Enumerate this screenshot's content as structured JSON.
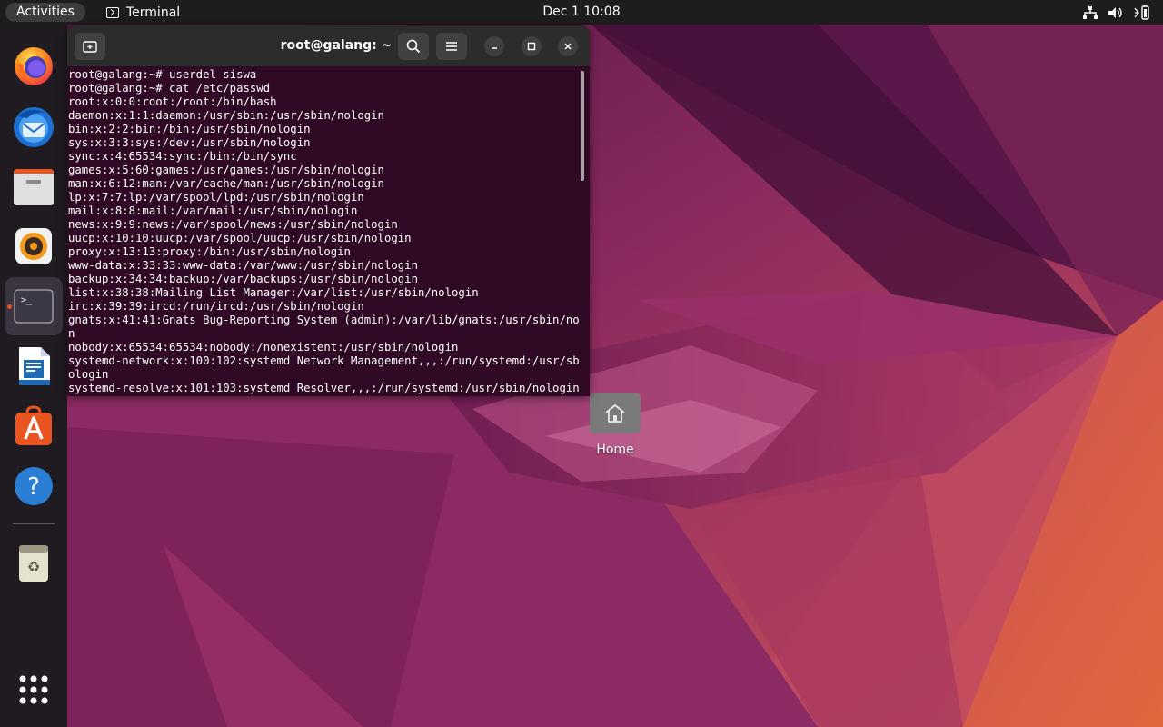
{
  "topbar": {
    "activities_label": "Activities",
    "app_name": "Terminal",
    "clock": "Dec 1  10:08"
  },
  "dock": {
    "items": [
      {
        "name": "Firefox",
        "icon": "firefox-icon"
      },
      {
        "name": "Thunderbird",
        "icon": "thunderbird-icon"
      },
      {
        "name": "Files",
        "icon": "files-icon"
      },
      {
        "name": "Rhythmbox",
        "icon": "rhythmbox-icon"
      },
      {
        "name": "Terminal",
        "icon": "terminal-icon",
        "active": true,
        "prompt_glyph": ">_"
      },
      {
        "name": "LibreOffice Writer",
        "icon": "writer-icon"
      },
      {
        "name": "Ubuntu Software",
        "icon": "software-icon"
      },
      {
        "name": "Help",
        "icon": "help-icon",
        "glyph": "?"
      },
      {
        "name": "Trash",
        "icon": "trash-icon"
      },
      {
        "name": "Show Applications",
        "icon": "app-grid-icon"
      }
    ]
  },
  "terminal": {
    "title": "root@galang: ~",
    "lines": [
      "root@galang:~# userdel siswa",
      "root@galang:~# cat /etc/passwd",
      "root:x:0:0:root:/root:/bin/bash",
      "daemon:x:1:1:daemon:/usr/sbin:/usr/sbin/nologin",
      "bin:x:2:2:bin:/bin:/usr/sbin/nologin",
      "sys:x:3:3:sys:/dev:/usr/sbin/nologin",
      "sync:x:4:65534:sync:/bin:/bin/sync",
      "games:x:5:60:games:/usr/games:/usr/sbin/nologin",
      "man:x:6:12:man:/var/cache/man:/usr/sbin/nologin",
      "lp:x:7:7:lp:/var/spool/lpd:/usr/sbin/nologin",
      "mail:x:8:8:mail:/var/mail:/usr/sbin/nologin",
      "news:x:9:9:news:/var/spool/news:/usr/sbin/nologin",
      "uucp:x:10:10:uucp:/var/spool/uucp:/usr/sbin/nologin",
      "proxy:x:13:13:proxy:/bin:/usr/sbin/nologin",
      "www-data:x:33:33:www-data:/var/www:/usr/sbin/nologin",
      "backup:x:34:34:backup:/var/backups:/usr/sbin/nologin",
      "list:x:38:38:Mailing List Manager:/var/list:/usr/sbin/nologin",
      "irc:x:39:39:ircd:/run/ircd:/usr/sbin/nologin",
      "gnats:x:41:41:Gnats Bug-Reporting System (admin):/var/lib/gnats:/usr/sbin/nologi",
      "n",
      "nobody:x:65534:65534:nobody:/nonexistent:/usr/sbin/nologin",
      "systemd-network:x:100:102:systemd Network Management,,,:/run/systemd:/usr/sbin/n",
      "ologin",
      "systemd-resolve:x:101:103:systemd Resolver,,,:/run/systemd:/usr/sbin/nologin"
    ]
  },
  "desktop": {
    "home_label": "Home"
  },
  "colors": {
    "terminal_bg": "#300a24",
    "topbar_bg": "#1d1d1d",
    "accent": "#e95420"
  }
}
